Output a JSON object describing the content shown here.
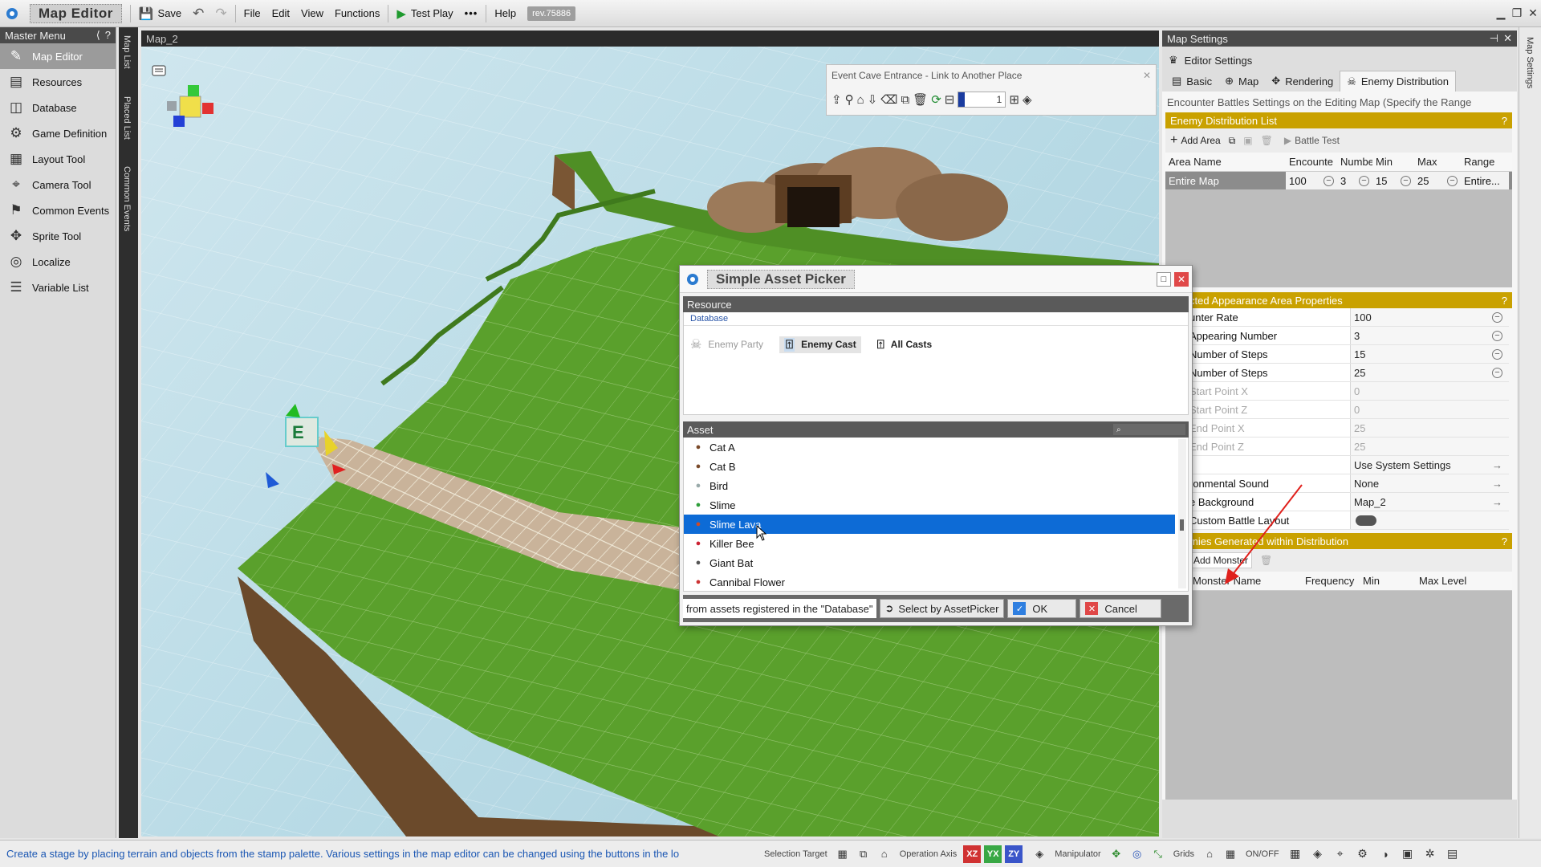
{
  "topbar": {
    "app_title": "Map Editor",
    "save_label": "Save",
    "menus": [
      "File",
      "Edit",
      "View",
      "Functions"
    ],
    "test_play_label": "Test Play",
    "help_label": "Help",
    "revision": "rev.75886"
  },
  "master_menu": {
    "title": "Master Menu",
    "items": [
      {
        "label": "Map Editor",
        "icon": "map-editor-icon"
      },
      {
        "label": "Resources",
        "icon": "resources-icon"
      },
      {
        "label": "Database",
        "icon": "database-icon"
      },
      {
        "label": "Game Definition",
        "icon": "game-definition-icon"
      },
      {
        "label": "Layout Tool",
        "icon": "layout-tool-icon"
      },
      {
        "label": "Camera Tool",
        "icon": "camera-tool-icon"
      },
      {
        "label": "Common Events",
        "icon": "common-events-icon"
      },
      {
        "label": "Sprite Tool",
        "icon": "sprite-tool-icon"
      },
      {
        "label": "Localize",
        "icon": "localize-icon"
      },
      {
        "label": "Variable List",
        "icon": "variable-list-icon"
      }
    ],
    "side_tabs": [
      "Map List",
      "Placed List",
      "Common Events"
    ]
  },
  "viewport": {
    "title": "Map_2",
    "event_bar_title": "Event Cave Entrance - Link to Another Place",
    "layer_value": "1"
  },
  "dialog": {
    "title": "Simple Asset Picker",
    "resource_header": "Resource",
    "resource_sub": "Database",
    "resource_types": [
      "Enemy Party",
      "Enemy Cast",
      "All Casts"
    ],
    "asset_header": "Asset",
    "assets": [
      "Cat A",
      "Cat B",
      "Bird",
      "Slime",
      "Slime Lava",
      "Killer Bee",
      "Giant Bat",
      "Cannibal Flower"
    ],
    "selected_asset": "Slime Lava",
    "footer_text": "from assets registered in the \"Database\"",
    "select_by_picker_label": "Select by AssetPicker",
    "ok_label": "OK",
    "cancel_label": "Cancel"
  },
  "map_settings": {
    "title": "Map Settings",
    "editor_settings_label": "Editor Settings",
    "tabs": [
      "Basic",
      "Map",
      "Rendering",
      "Enemy Distribution"
    ],
    "description": "Encounter Battles Settings on the Editing Map (Specify the Range",
    "dist_list_header": "Enemy Distribution List",
    "add_area_label": "Add Area",
    "battle_test_label": "Battle Test",
    "grid_columns": [
      "Area Name",
      "Encounte",
      "Numbe",
      "Min",
      "Max",
      "Range"
    ],
    "grid_row": {
      "area": "Entire Map",
      "encounter": "100",
      "number": "3",
      "min": "15",
      "max": "25",
      "range": "Entire..."
    },
    "props_header": "cted Appearance Area Properties",
    "props": [
      {
        "key": "unter Rate",
        "value": "100",
        "disabled": false,
        "control": "minus"
      },
      {
        "key": "Appearing Number",
        "value": "3",
        "disabled": false,
        "control": "minus"
      },
      {
        "key": "Number of Steps",
        "value": "15",
        "disabled": false,
        "control": "minus"
      },
      {
        "key": "Number of Steps",
        "value": "25",
        "disabled": false,
        "control": "minus"
      },
      {
        "key": "Start Point X",
        "value": "0",
        "disabled": true,
        "control": ""
      },
      {
        "key": "Start Point Z",
        "value": "0",
        "disabled": true,
        "control": ""
      },
      {
        "key": "End Point X",
        "value": "25",
        "disabled": true,
        "control": ""
      },
      {
        "key": "End Point Z",
        "value": "25",
        "disabled": true,
        "control": ""
      },
      {
        "key": "",
        "value": "Use System Settings",
        "disabled": false,
        "control": "arrow"
      },
      {
        "key": "ronmental Sound",
        "value": "None",
        "disabled": false,
        "control": "arrow"
      },
      {
        "key": "e Background",
        "value": "Map_2",
        "disabled": false,
        "control": "arrow"
      },
      {
        "key": "Custom Battle Layout",
        "value": "",
        "disabled": false,
        "control": "toggle"
      }
    ],
    "enemies_header": "mies Generated within Distribution",
    "add_monster_label": "Add Monster",
    "monster_columns": [
      "Monster Name",
      "Frequency",
      "Min",
      "Max Level"
    ],
    "side_tab": "Map Settings"
  },
  "status_bar": {
    "message": "Create a stage by placing terrain and objects from the stamp palette.  Various settings in the map editor can be changed using the buttons in the lo",
    "selection_target": "Selection Target",
    "operation_axis": "Operation Axis",
    "axis_xz": "XZ",
    "axis_yx": "YX",
    "axis_zy": "ZY",
    "manipulator": "Manipulator",
    "grids": "Grids",
    "onoff": "ON/OFF"
  },
  "colors": {
    "accent_gold": "#c9a100",
    "selection_blue": "#0d6bd6",
    "grass": "#5aa02c",
    "annotation_arrow": "#e0201c"
  }
}
